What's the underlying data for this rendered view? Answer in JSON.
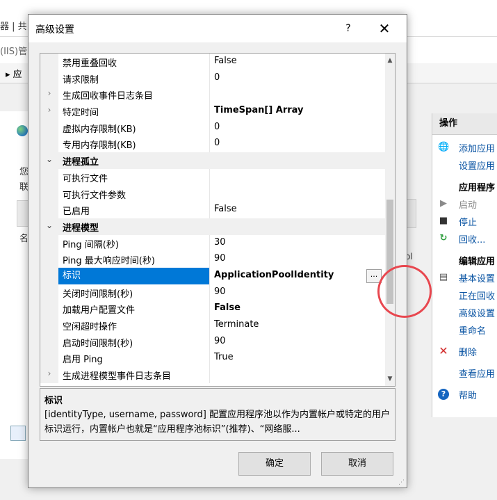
{
  "background": {
    "top_text": "器 | 共 1",
    "address_text": "(IIS)管",
    "toolbar_text": "▸ 应",
    "left_label1": "您",
    "left_label2": "联",
    "left_row": "名",
    "right_row_text": "ol"
  },
  "actions_panel": {
    "header": "操作",
    "items": [
      {
        "label": "添加应用",
        "icon": "add-app-icon",
        "kind": "link"
      },
      {
        "label": "设置应用",
        "icon": "",
        "kind": "link"
      },
      {
        "label": "应用程序",
        "icon": "",
        "kind": "section"
      },
      {
        "label": "启动",
        "icon": "play-icon",
        "kind": "disabled"
      },
      {
        "label": "停止",
        "icon": "stop-icon",
        "kind": "link"
      },
      {
        "label": "回收...",
        "icon": "recycle-icon",
        "kind": "link"
      },
      {
        "label": "编辑应用",
        "icon": "",
        "kind": "section"
      },
      {
        "label": "基本设置",
        "icon": "settings-icon",
        "kind": "link"
      },
      {
        "label": "正在回收",
        "icon": "",
        "kind": "link"
      },
      {
        "label": "高级设置",
        "icon": "",
        "kind": "link"
      },
      {
        "label": "重命名",
        "icon": "",
        "kind": "link"
      },
      {
        "label": "删除",
        "icon": "delete-icon",
        "kind": "link"
      },
      {
        "label": "查看应用",
        "icon": "",
        "kind": "link"
      },
      {
        "label": "帮助",
        "icon": "help-icon",
        "kind": "link"
      }
    ]
  },
  "dialog": {
    "title": "高级设置",
    "help_glyph": "?",
    "close_glyph": "✕",
    "rows": [
      {
        "name": "禁用重叠回收",
        "value": "False",
        "type": "prop",
        "chevron": "",
        "bold": false
      },
      {
        "name": "请求限制",
        "value": "0",
        "type": "prop",
        "chevron": "",
        "bold": false
      },
      {
        "name": "生成回收事件日志条目",
        "value": "",
        "type": "prop",
        "chevron": "›",
        "bold": false
      },
      {
        "name": "特定时间",
        "value": "TimeSpan[] Array",
        "type": "prop",
        "chevron": "›",
        "bold": true
      },
      {
        "name": "虚拟内存限制(KB)",
        "value": "0",
        "type": "prop",
        "chevron": "",
        "bold": false
      },
      {
        "name": "专用内存限制(KB)",
        "value": "0",
        "type": "prop",
        "chevron": "",
        "bold": false
      },
      {
        "name": "进程孤立",
        "value": "",
        "type": "category",
        "chevron": "⌄",
        "bold": false
      },
      {
        "name": "可执行文件",
        "value": "",
        "type": "prop",
        "chevron": "",
        "bold": false
      },
      {
        "name": "可执行文件参数",
        "value": "",
        "type": "prop",
        "chevron": "",
        "bold": false
      },
      {
        "name": "已启用",
        "value": "False",
        "type": "prop",
        "chevron": "",
        "bold": false
      },
      {
        "name": "进程模型",
        "value": "",
        "type": "category",
        "chevron": "⌄",
        "bold": false
      },
      {
        "name": "Ping 间隔(秒)",
        "value": "30",
        "type": "prop",
        "chevron": "",
        "bold": false
      },
      {
        "name": "Ping 最大响应时间(秒)",
        "value": "90",
        "type": "prop",
        "chevron": "",
        "bold": false
      },
      {
        "name": "标识",
        "value": "ApplicationPoolIdentity",
        "type": "selected",
        "chevron": "",
        "bold": true
      },
      {
        "name": "关闭时间限制(秒)",
        "value": "90",
        "type": "prop",
        "chevron": "",
        "bold": false
      },
      {
        "name": "加载用户配置文件",
        "value": "False",
        "type": "prop",
        "chevron": "",
        "bold": true
      },
      {
        "name": "空闲超时操作",
        "value": "Terminate",
        "type": "prop",
        "chevron": "",
        "bold": false
      },
      {
        "name": "启动时间限制(秒)",
        "value": "90",
        "type": "prop",
        "chevron": "",
        "bold": false
      },
      {
        "name": "启用 Ping",
        "value": "True",
        "type": "prop",
        "chevron": "",
        "bold": false
      },
      {
        "name": "生成进程模型事件日志条目",
        "value": "",
        "type": "prop",
        "chevron": "›",
        "bold": false
      }
    ],
    "ellipsis_label": "...",
    "scroll_up": "▲",
    "scroll_down": "▼",
    "description": {
      "title": "标识",
      "text": "[identityType, username, password] 配置应用程序池以作为内置帐户或特定的用户标识运行，内置帐户也就是“应用程序池标识”(推荐)、“网络服..."
    },
    "ok_label": "确定",
    "cancel_label": "取消"
  },
  "colors": {
    "selection": "#0078d7",
    "annotation": "#e8474f",
    "link": "#0a54a3"
  }
}
